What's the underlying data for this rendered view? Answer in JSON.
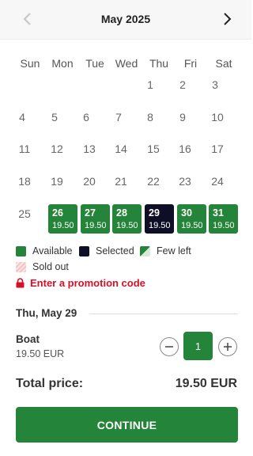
{
  "header": {
    "month": "May 2025",
    "prev_icon": "chevron-left-icon",
    "next_icon": "chevron-right-icon"
  },
  "weekdays": [
    "Sun",
    "Mon",
    "Tue",
    "Wed",
    "Thu",
    "Fri",
    "Sat"
  ],
  "days": {
    "plain": [
      "1",
      "2",
      "3",
      "4",
      "5",
      "6",
      "7",
      "8",
      "9",
      "10",
      "11",
      "12",
      "13",
      "14",
      "15",
      "16",
      "17",
      "18",
      "19",
      "20",
      "21",
      "22",
      "23",
      "24",
      "25"
    ],
    "available": [
      {
        "day": "26",
        "price": "19.50",
        "status": "available"
      },
      {
        "day": "27",
        "price": "19.50",
        "status": "available"
      },
      {
        "day": "28",
        "price": "19.50",
        "status": "available"
      },
      {
        "day": "29",
        "price": "19.50",
        "status": "selected"
      },
      {
        "day": "30",
        "price": "19.50",
        "status": "available"
      },
      {
        "day": "31",
        "price": "19.50",
        "status": "available"
      }
    ]
  },
  "legend": {
    "available": "Available",
    "selected": "Selected",
    "few_left": "Few left",
    "sold_out": "Sold out"
  },
  "promo": {
    "label": "Enter a promotion code",
    "icon": "lock-icon"
  },
  "selection": {
    "date_label": "Thu, May 29"
  },
  "ticket": {
    "name": "Boat",
    "price": "19.50 EUR",
    "quantity": "1"
  },
  "total": {
    "label": "Total price:",
    "value": "19.50 EUR"
  },
  "continue_label": "CONTINUE",
  "colors": {
    "accent": "#24853a",
    "selected": "#0e0e26",
    "promo": "#d60f2a",
    "sold_out": "#f4c4c4"
  }
}
